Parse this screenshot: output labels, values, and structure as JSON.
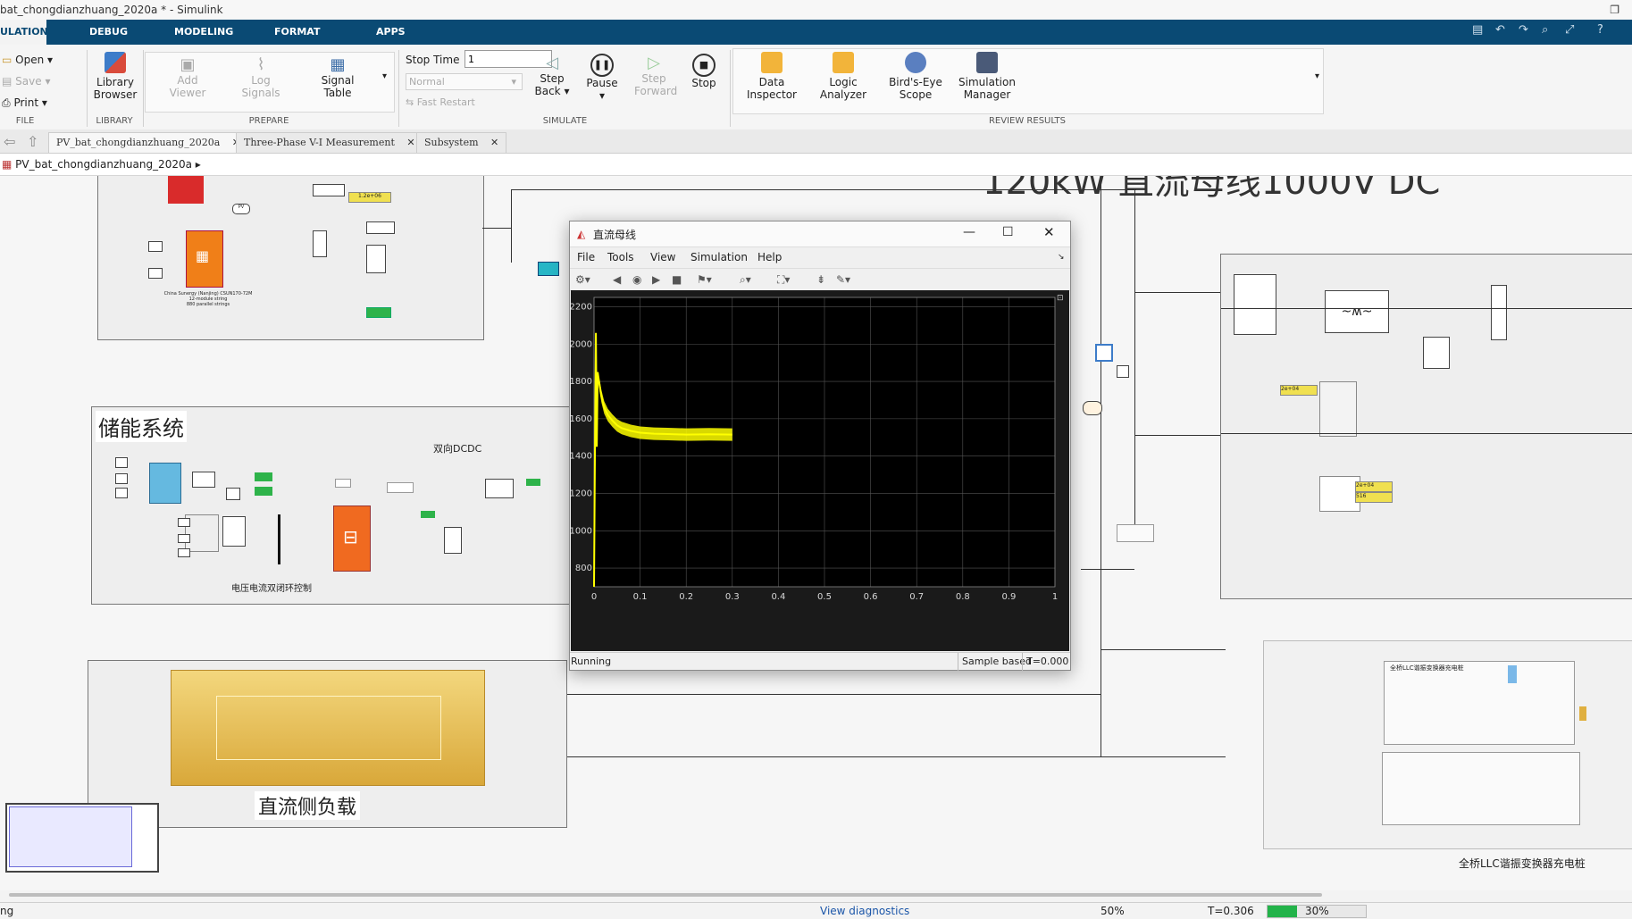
{
  "window": {
    "title": "bat_chongdianzhuang_2020a * - Simulink"
  },
  "tabs": [
    {
      "label": "ULATION"
    },
    {
      "label": "DEBUG"
    },
    {
      "label": "MODELING"
    },
    {
      "label": "FORMAT"
    },
    {
      "label": "APPS"
    }
  ],
  "ribbon": {
    "file": {
      "open": "Open",
      "save": "Save",
      "print": "Print",
      "section": "FILE"
    },
    "library": {
      "browser_l1": "Library",
      "browser_l2": "Browser",
      "section": "LIBRARY"
    },
    "prepare": {
      "add_viewer_l1": "Add",
      "add_viewer_l2": "Viewer",
      "log_signals_l1": "Log",
      "log_signals_l2": "Signals",
      "signal_table_l1": "Signal",
      "signal_table_l2": "Table",
      "section": "PREPARE"
    },
    "simulate": {
      "stop_time_label": "Stop Time",
      "stop_time_value": "1",
      "mode": "Normal",
      "fast_restart": "Fast Restart",
      "step_back_l1": "Step",
      "step_back_l2": "Back",
      "pause": "Pause",
      "step_forward_l1": "Step",
      "step_forward_l2": "Forward",
      "stop": "Stop",
      "section": "SIMULATE"
    },
    "review": {
      "data_inspector_l1": "Data",
      "data_inspector_l2": "Inspector",
      "logic_analyzer_l1": "Logic",
      "logic_analyzer_l2": "Analyzer",
      "birds_eye_l1": "Bird's-Eye",
      "birds_eye_l2": "Scope",
      "sim_manager_l1": "Simulation",
      "sim_manager_l2": "Manager",
      "section": "REVIEW RESULTS"
    }
  },
  "doc_tabs": [
    {
      "label": "PV_bat_chongdianzhuang_2020a"
    },
    {
      "label": "Three-Phase V-I Measurement"
    },
    {
      "label": "Subsystem"
    }
  ],
  "breadcrumb": "PV_bat_chongdianzhuang_2020a",
  "canvas": {
    "storage_title": "储能系统",
    "dcdc_label": "双向DCDC",
    "control_label": "电压电流双闭环控制",
    "load_title": "直流侧负载",
    "charger_title": "全桥LLC谐振变换器充电桩",
    "charger_inner": "全桥LLC谐振变换器充电桩",
    "pv_caption": "China Sunergy (Nanjing) CSUN170-72M\n12-module string\n880 parallel strings",
    "display1": "1.2e+06",
    "display2": "2e+04",
    "display3": "2e+04",
    "display4": "516",
    "pv_tag": "PV",
    "big_title_fragment": "120kW 直流母线1000V DC"
  },
  "scope": {
    "title": "直流母线",
    "menu": [
      "File",
      "Tools",
      "View",
      "Simulation",
      "Help"
    ],
    "status_left": "Running",
    "status_sample": "Sample based",
    "status_time": "T=0.000"
  },
  "chart_data": {
    "type": "line",
    "title": "",
    "xlabel": "",
    "ylabel": "",
    "xlim": [
      0,
      1
    ],
    "ylim": [
      700,
      2250
    ],
    "xticks": [
      "0",
      "0.1",
      "0.2",
      "0.3",
      "0.4",
      "0.5",
      "0.6",
      "0.7",
      "0.8",
      "0.9",
      "1"
    ],
    "yticks": [
      "800",
      "1000",
      "1200",
      "1400",
      "1600",
      "1800",
      "2000",
      "2200"
    ],
    "background": "#000000",
    "grid": true,
    "series": [
      {
        "color": "#ffff00",
        "x": [
          0,
          0.002,
          0.004,
          0.006,
          0.008,
          0.012,
          0.016,
          0.022,
          0.03,
          0.04,
          0.05,
          0.06,
          0.08,
          0.1,
          0.13,
          0.16,
          0.2,
          0.25,
          0.3
        ],
        "y": [
          700,
          1400,
          2060,
          1450,
          1850,
          1780,
          1720,
          1660,
          1620,
          1590,
          1565,
          1550,
          1535,
          1525,
          1520,
          1518,
          1515,
          1517,
          1515
        ]
      }
    ]
  },
  "status": {
    "left": "ng",
    "diagnostics": "View diagnostics",
    "zoom": "50%",
    "time": "T=0.306",
    "progress_label": "30%",
    "progress": 0.3
  }
}
